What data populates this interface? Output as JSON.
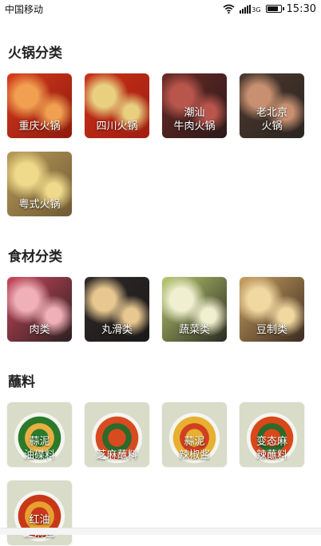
{
  "status": {
    "carrier": "中国移动",
    "network": "3G",
    "time": "15:30"
  },
  "sections": [
    {
      "title": "火锅分类",
      "items": [
        {
          "label": "重庆火锅",
          "colors": [
            "#d63a1e",
            "#f0a050",
            "#8c1a0c"
          ]
        },
        {
          "label": "四川火锅",
          "colors": [
            "#c83218",
            "#e8d080",
            "#a01c10"
          ]
        },
        {
          "label": "潮汕\n牛肉火锅",
          "colors": [
            "#6b2a28",
            "#b8564c",
            "#2a1a18"
          ]
        },
        {
          "label": "老北京\n火锅",
          "colors": [
            "#4e3a30",
            "#c89070",
            "#2a2420"
          ]
        },
        {
          "label": "粤式火锅",
          "colors": [
            "#b89a58",
            "#efd98a",
            "#6e5a34"
          ]
        }
      ]
    },
    {
      "title": "食材分类",
      "items": [
        {
          "label": "肉类",
          "colors": [
            "#c8465a",
            "#f0b0b8",
            "#2a2020"
          ]
        },
        {
          "label": "丸滑类",
          "colors": [
            "#302a28",
            "#e8c890",
            "#1a1818"
          ]
        },
        {
          "label": "蔬菜类",
          "colors": [
            "#b8c870",
            "#f0f0d0",
            "#2a2a20"
          ]
        },
        {
          "label": "豆制类",
          "colors": [
            "#c8a060",
            "#f0d8a0",
            "#3a2a20"
          ]
        }
      ]
    },
    {
      "title": "蘸料",
      "items": [
        {
          "label": "蒜泥\n油碟料",
          "colors": [
            "#d8dcc8",
            "#2a7a2a",
            "#e8b040"
          ]
        },
        {
          "label": "芝麻蘸料",
          "colors": [
            "#d8dcc8",
            "#d84a20",
            "#2a6a2a"
          ]
        },
        {
          "label": "蒜泥\n辣椒酱",
          "colors": [
            "#d8dcc8",
            "#e8b030",
            "#d04020"
          ]
        },
        {
          "label": "变态麻\n辣蘸料",
          "colors": [
            "#d8dcc8",
            "#d84818",
            "#2a6a2a"
          ]
        },
        {
          "label": "红油\n芝麻酱",
          "colors": [
            "#d8dcc8",
            "#c83818",
            "#e8a030"
          ]
        }
      ]
    }
  ]
}
